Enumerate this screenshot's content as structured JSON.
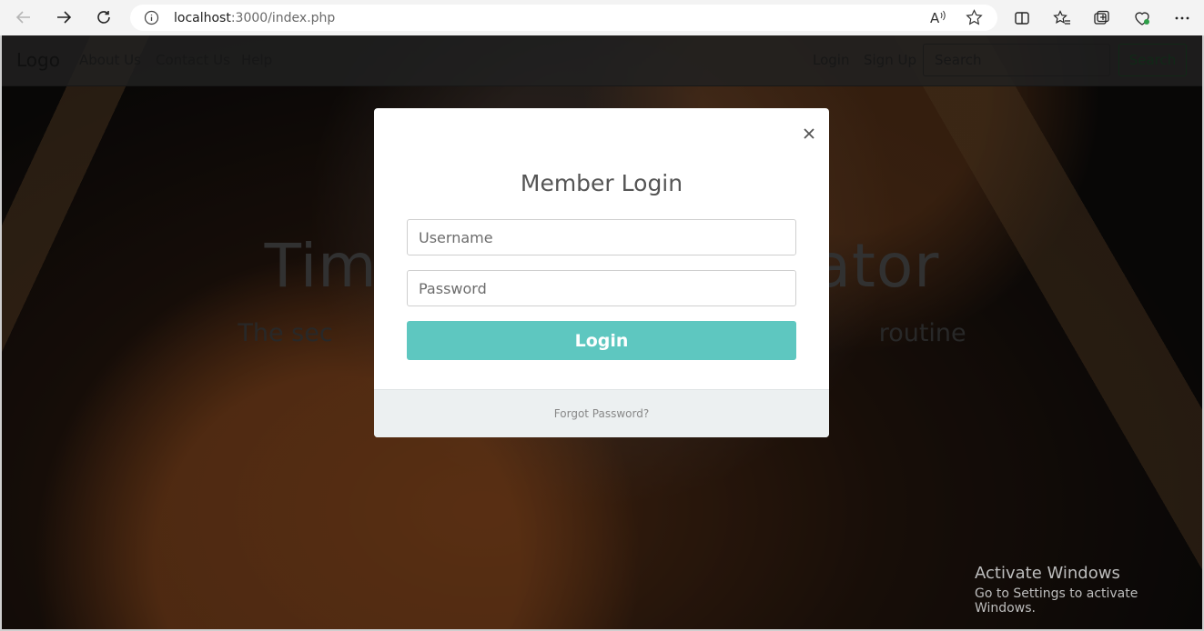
{
  "browser": {
    "url_host": "localhost",
    "url_rest": ":3000/index.php"
  },
  "nav": {
    "brand": "Logo",
    "links": [
      "About Us",
      "Contact Us",
      "Help"
    ],
    "login": "Login",
    "signup": "Sign Up",
    "search_placeholder": "Search",
    "search_button": "Search"
  },
  "hero": {
    "title_left": "Tim",
    "title_right": "ator",
    "sub_left": "The sec",
    "sub_right": "routine"
  },
  "modal": {
    "title": "Member Login",
    "username_placeholder": "Username",
    "password_placeholder": "Password",
    "login_button": "Login",
    "forgot": "Forgot Password?"
  },
  "watermark": {
    "line1": "Activate Windows",
    "line2": "Go to Settings to activate Windows."
  }
}
